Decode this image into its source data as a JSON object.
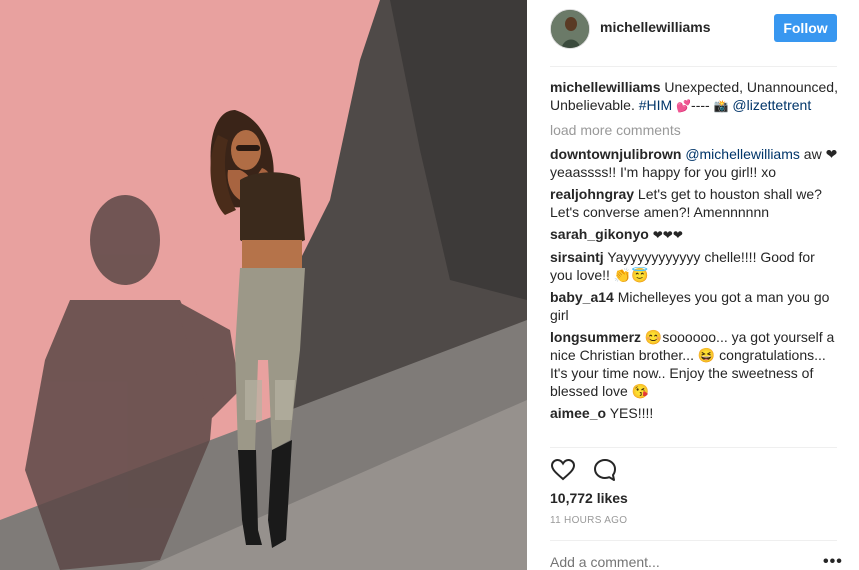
{
  "header": {
    "username": "michellewilliams",
    "follow_label": "Follow"
  },
  "caption": {
    "user": "michellewilliams",
    "text": "Unexpected, Unannounced, Unbelievable.",
    "hashtag": "#HIM",
    "suffix": "----",
    "mention": "@lizettetrent"
  },
  "load_more": "load more comments",
  "comments": [
    {
      "user": "downtownjulibrown",
      "mention": "@michellewilliams",
      "text": "aw ❤yeaassss!! I'm happy for you girl!! xo"
    },
    {
      "user": "realjohngray",
      "mention": "",
      "text": "Let's get to houston shall we? Let's converse amen?! Amennnnnn"
    },
    {
      "user": "sarah_gikonyo",
      "mention": "",
      "text": "❤❤❤"
    },
    {
      "user": "sirsaintj",
      "mention": "",
      "text": "Yayyyyyyyyyyy chelle!!!! Good for you love!! 👏😇"
    },
    {
      "user": "baby_a14",
      "mention": "",
      "text": "Michelleyes you got a man you go girl"
    },
    {
      "user": "longsummerz",
      "mention": "",
      "text": "😊soooooo... ya got yourself a nice Christian brother... 😆 congratulations... It's your time now.. Enjoy the sweetness of blessed love 😘"
    },
    {
      "user": "aimee_o",
      "mention": "",
      "text": "YES!!!!"
    }
  ],
  "likes": "10,772 likes",
  "time": "11 HOURS AGO",
  "add_comment_placeholder": "Add a comment...",
  "more_options": "•••",
  "icons": {
    "like": "heart-icon",
    "comment": "speech-bubble-icon",
    "more": "more-options-icon"
  },
  "colors": {
    "accent": "#3897f0",
    "wall": "#e59c9b",
    "link": "#003569",
    "muted": "#999999"
  }
}
